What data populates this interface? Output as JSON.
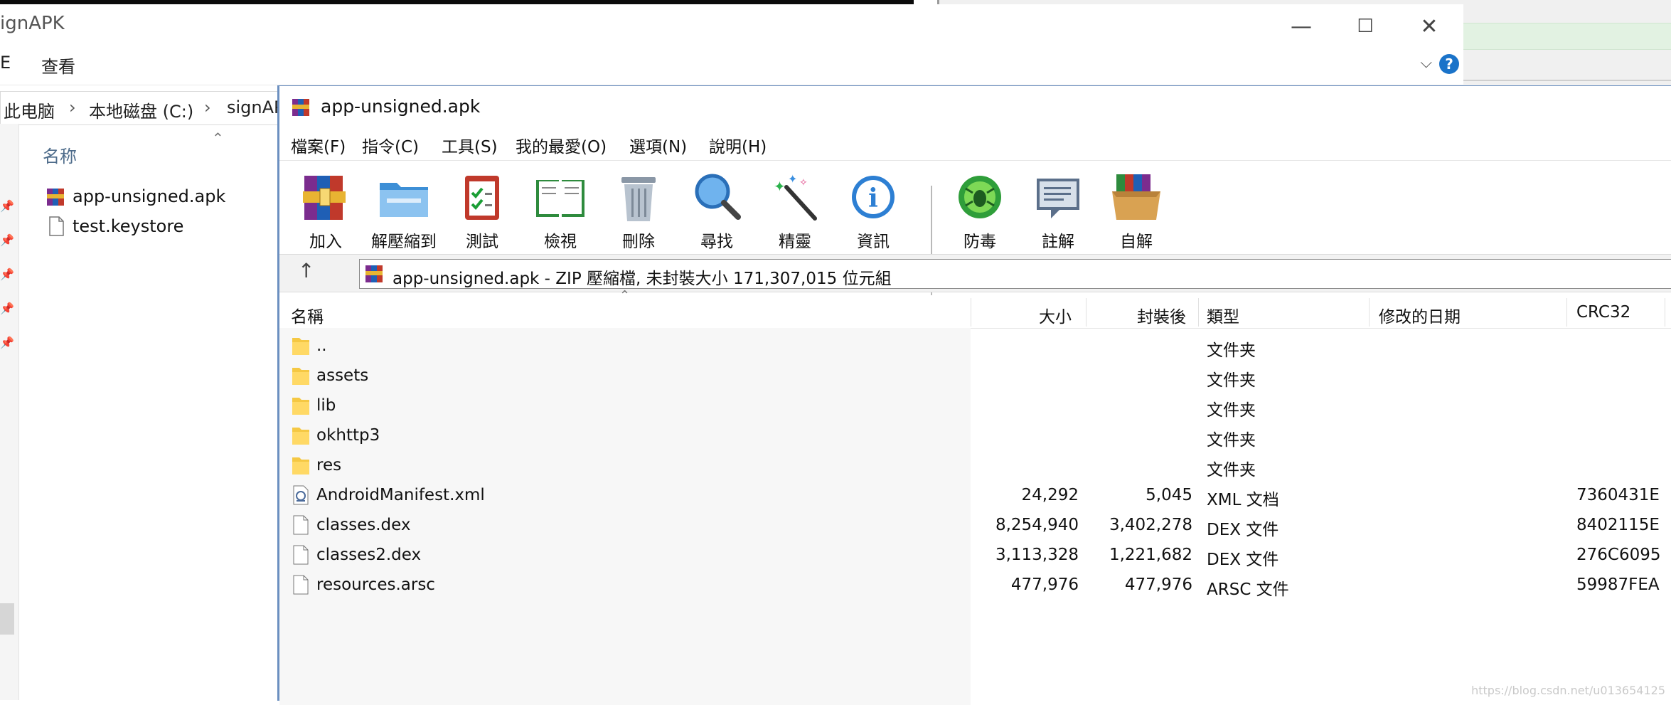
{
  "explorer": {
    "title": "ignAPK",
    "menu_left": "E",
    "menu_view": "查看",
    "breadcrumb": [
      "此电脑",
      "本地磁盘 (C:)",
      "signAP"
    ],
    "column_name": "名称",
    "files": [
      {
        "name": "app-unsigned.apk",
        "icon": "winrar-archive-icon"
      },
      {
        "name": "test.keystore",
        "icon": "file-icon"
      }
    ],
    "window_buttons": {
      "minimize": "—",
      "maximize": "☐",
      "close": "✕"
    },
    "help": "?"
  },
  "winrar": {
    "title": "app-unsigned.apk",
    "menu": [
      "檔案(F)",
      "指令(C)",
      "工具(S)",
      "我的最愛(O)",
      "選項(N)",
      "說明(H)"
    ],
    "toolbar": [
      {
        "label": "加入",
        "icon": "add-archive-icon"
      },
      {
        "label": "解壓縮到",
        "icon": "extract-folder-icon"
      },
      {
        "label": "測試",
        "icon": "test-clipboard-icon"
      },
      {
        "label": "檢視",
        "icon": "view-book-icon"
      },
      {
        "label": "刪除",
        "icon": "trash-icon"
      },
      {
        "label": "尋找",
        "icon": "magnifier-icon"
      },
      {
        "label": "精靈",
        "icon": "wizard-wand-icon"
      },
      {
        "label": "資訊",
        "icon": "info-icon"
      },
      {
        "label": "防毒",
        "icon": "virus-scan-icon"
      },
      {
        "label": "註解",
        "icon": "comment-icon"
      },
      {
        "label": "自解",
        "icon": "sfx-box-icon"
      }
    ],
    "path": "app-unsigned.apk - ZIP 壓縮檔, 未封裝大小 171,307,015 位元組",
    "columns": [
      "名稱",
      "大小",
      "封裝後",
      "類型",
      "修改的日期",
      "CRC32"
    ],
    "rows": [
      {
        "name": "..",
        "size": "",
        "packed": "",
        "type": "文件夹",
        "modified": "",
        "crc": "",
        "icon": "folder-icon"
      },
      {
        "name": "assets",
        "size": "",
        "packed": "",
        "type": "文件夹",
        "modified": "",
        "crc": "",
        "icon": "folder-icon"
      },
      {
        "name": "lib",
        "size": "",
        "packed": "",
        "type": "文件夹",
        "modified": "",
        "crc": "",
        "icon": "folder-icon"
      },
      {
        "name": "okhttp3",
        "size": "",
        "packed": "",
        "type": "文件夹",
        "modified": "",
        "crc": "",
        "icon": "folder-icon"
      },
      {
        "name": "res",
        "size": "",
        "packed": "",
        "type": "文件夹",
        "modified": "",
        "crc": "",
        "icon": "folder-icon"
      },
      {
        "name": "AndroidManifest.xml",
        "size": "24,292",
        "packed": "5,045",
        "type": "XML 文档",
        "modified": "",
        "crc": "7360431E",
        "icon": "xml-file-icon"
      },
      {
        "name": "classes.dex",
        "size": "8,254,940",
        "packed": "3,402,278",
        "type": "DEX 文件",
        "modified": "",
        "crc": "8402115E",
        "icon": "file-icon"
      },
      {
        "name": "classes2.dex",
        "size": "3,113,328",
        "packed": "1,221,682",
        "type": "DEX 文件",
        "modified": "",
        "crc": "276C6095",
        "icon": "file-icon"
      },
      {
        "name": "resources.arsc",
        "size": "477,976",
        "packed": "477,976",
        "type": "ARSC 文件",
        "modified": "",
        "crc": "59987FEA",
        "icon": "file-icon"
      }
    ]
  },
  "watermark": "https://blog.csdn.net/u013654125"
}
